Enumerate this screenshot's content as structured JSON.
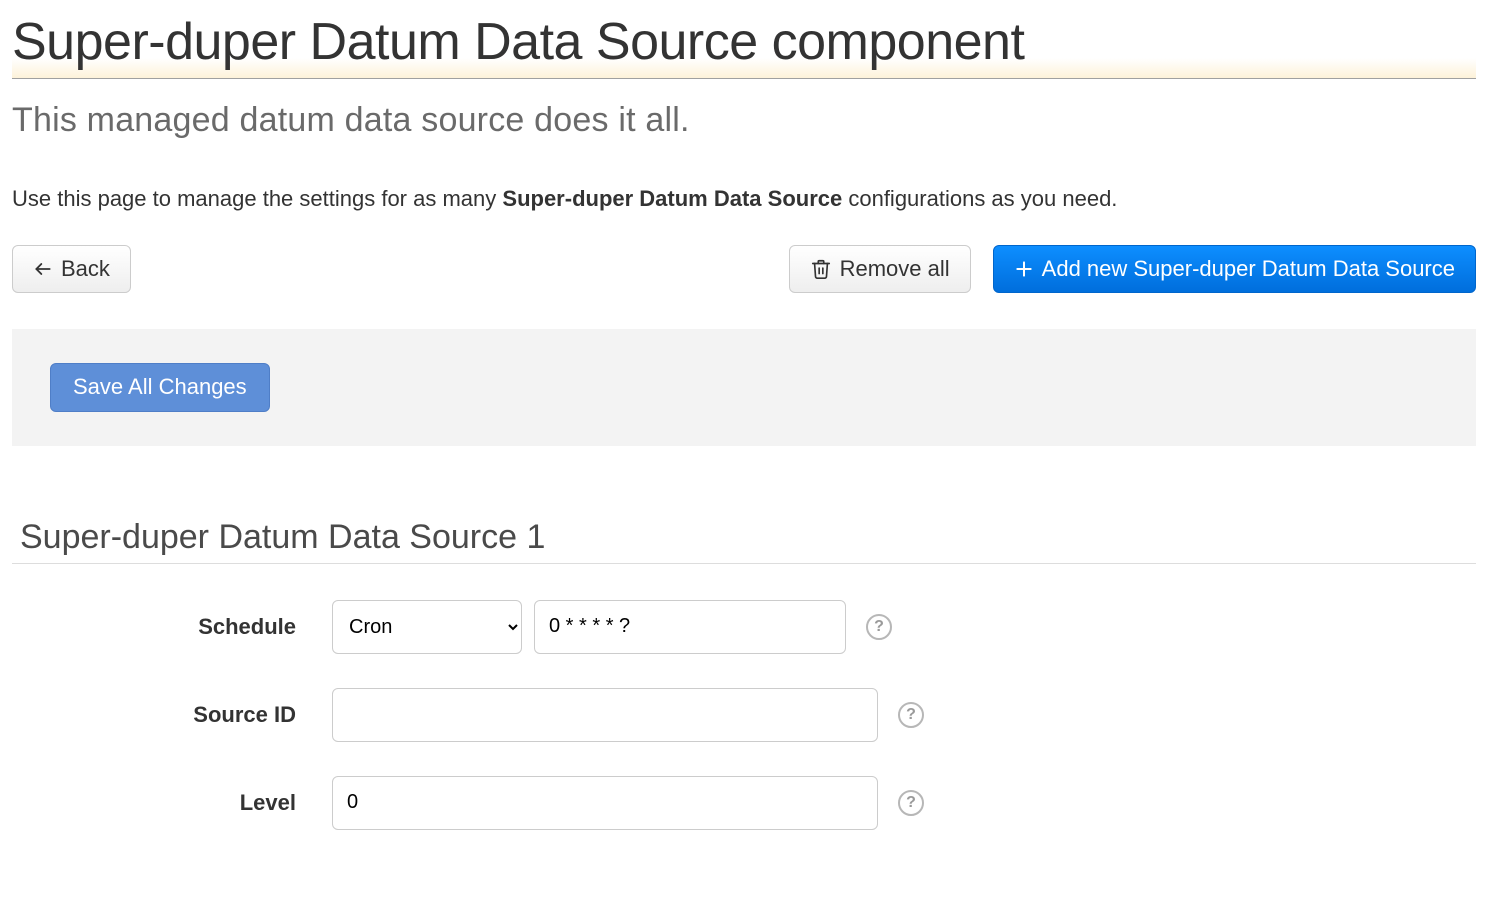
{
  "header": {
    "title": "Super-duper Datum Data Source component",
    "subtitle": "This managed datum data source does it all.",
    "instruction_prefix": "Use this page to manage the settings for as many ",
    "instruction_strong": "Super-duper Datum Data Source",
    "instruction_suffix": " configurations as you need."
  },
  "buttons": {
    "back": "Back",
    "remove_all": "Remove all",
    "add_new": "Add new Super-duper Datum Data Source",
    "save_all": "Save All Changes"
  },
  "section": {
    "title": "Super-duper Datum Data Source 1"
  },
  "form": {
    "schedule": {
      "label": "Schedule",
      "select_value": "Cron",
      "input_value": "0 * * * * ?"
    },
    "source_id": {
      "label": "Source ID",
      "value": ""
    },
    "level": {
      "label": "Level",
      "value": "0"
    }
  },
  "help_glyph": "?"
}
